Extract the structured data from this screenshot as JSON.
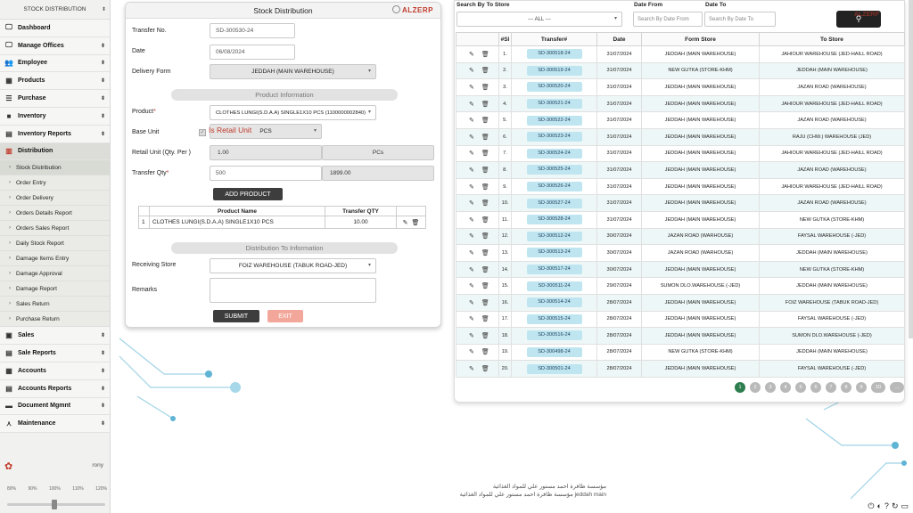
{
  "sidebar": {
    "top_label": "STOCK DISTRIBUTION",
    "menu_before": [
      {
        "label": "Dashboard",
        "icon": "monitor-icon",
        "glyph": "🖵",
        "arrow": ""
      },
      {
        "label": "Manage Offices",
        "icon": "monitor-icon",
        "glyph": "🖵",
        "arrow": "⬍"
      },
      {
        "label": "Employee",
        "icon": "users-icon",
        "glyph": "👥",
        "arrow": "⬍"
      },
      {
        "label": "Products",
        "icon": "grid-icon",
        "glyph": "▦",
        "arrow": "⬍"
      },
      {
        "label": "Purchase",
        "icon": "list-icon",
        "glyph": "☰",
        "arrow": "⬍"
      },
      {
        "label": "Inventory",
        "icon": "box-icon",
        "glyph": "■",
        "arrow": "⬍"
      },
      {
        "label": "Inventory Reports",
        "icon": "chart-icon",
        "glyph": "▤",
        "arrow": "⬍"
      },
      {
        "label": "Distribution",
        "icon": "map-icon",
        "glyph": "▥",
        "arrow": ""
      }
    ],
    "submenu": [
      "Stock Distribution",
      "Order Entry",
      "Order Delivery",
      "Orders Details Report",
      "Orders Sales Report",
      "Daily Stock Report",
      "Damage Items Entry",
      "Damage Approval",
      "Damage Report",
      "Sales Return",
      "Purchase Return"
    ],
    "menu_after": [
      {
        "label": "Sales",
        "icon": "building-icon",
        "glyph": "▣",
        "arrow": "⬍"
      },
      {
        "label": "Sale Reports",
        "icon": "report-icon",
        "glyph": "▤",
        "arrow": "⬍"
      },
      {
        "label": "Accounts",
        "icon": "accounts-icon",
        "glyph": "▦",
        "arrow": "⬍"
      },
      {
        "label": "Accounts Reports",
        "icon": "report-icon",
        "glyph": "▤",
        "arrow": "⬍"
      },
      {
        "label": "Document Mgmnt",
        "icon": "document-icon",
        "glyph": "▬",
        "arrow": "⬍"
      },
      {
        "label": "Maintenance",
        "icon": "wrench-icon",
        "glyph": "⋏",
        "arrow": "⬍"
      }
    ],
    "user": "rony",
    "zoom_levels": [
      "80%",
      "90%",
      "100%",
      "110%",
      "120%"
    ]
  },
  "form": {
    "title": "Stock Distribution",
    "brand": "ALZERP",
    "transfer_no_label": "Transfer No.",
    "transfer_no": "SD-300530-24",
    "date_label": "Date",
    "date": "06/08/2024",
    "delivery_form_label": "Delivery Form",
    "delivery_form": "JEDDAH (MAIN WAREHOUSE)",
    "product_info_label": "Product Information",
    "product_label": "Product",
    "product": "CLOTHES LUNGI(S.D.A.A) SINGLE1X10 PCS (1100000002840)",
    "base_unit_label": "Base Unit",
    "base_unit": "PCS",
    "is_retail_label": "Is Retail Unit",
    "retail_unit_label": "Retail Unit (Qty. Per )",
    "retail_qty": "1.00",
    "retail_unit": "PCs",
    "transfer_qty_label": "Transfer Qty",
    "transfer_qty": "500",
    "transfer_stock": "1899.00",
    "add_product": "ADD PRODUCT",
    "table_headers": {
      "name": "Product Name",
      "qty": "Transfer QTY"
    },
    "rows": [
      {
        "num": "1",
        "name": "CLOTHES LUNGI(S.D.A.A) SINGLE1X10 PCS",
        "qty": "10.00"
      }
    ],
    "dist_to_label": "Distribution To Information",
    "receiving_label": "Receiving Store",
    "receiving_store": "FOIZ WAREHOUSE (TABUK ROAD-JED)",
    "remarks_label": "Remarks",
    "submit": "SUBMIT",
    "exit": "EXIT"
  },
  "filters": {
    "store_label": "Search By To Store",
    "store_value": "--- ALL ---",
    "date_from_label": "Date From",
    "date_from_placeholder": "Search By Date From",
    "date_to_label": "Date To",
    "date_to_placeholder": "Search By Date To",
    "brand": "ALZERP"
  },
  "list": {
    "headers": [
      "",
      "#Sl",
      "Transfer#",
      "Date",
      "Form Store",
      "To Store"
    ],
    "rows": [
      {
        "sl": "1.",
        "transfer": "SD-300518-24",
        "date": "31/07/2024",
        "from": "JEDDAH (MAIN WAREHOUSE)",
        "to": "JAHIOUR WAREHOUSE (JED-HAILL ROAD)"
      },
      {
        "sl": "2.",
        "transfer": "SD-300519-24",
        "date": "31/07/2024",
        "from": "NEW GUTKA (STORE-KHM)",
        "to": "JEDDAH (MAIN WAREHOUSE)"
      },
      {
        "sl": "3.",
        "transfer": "SD-300520-24",
        "date": "31/07/2024",
        "from": "JEDDAH (MAIN WAREHOUSE)",
        "to": "JAZAN ROAD (WAREHOUSE)"
      },
      {
        "sl": "4.",
        "transfer": "SD-300521-24",
        "date": "31/07/2024",
        "from": "JEDDAH (MAIN WAREHOUSE)",
        "to": "JAHIOUR WAREHOUSE (JED-HAILL ROAD)"
      },
      {
        "sl": "5.",
        "transfer": "SD-300522-24",
        "date": "31/07/2024",
        "from": "JEDDAH (MAIN WAREHOUSE)",
        "to": "JAZAN ROAD (WAREHOUSE)"
      },
      {
        "sl": "6.",
        "transfer": "SD-300523-24",
        "date": "31/07/2024",
        "from": "JEDDAH (MAIN WAREHOUSE)",
        "to": "RAJU (CHW.) WAREHOUSE (JED)"
      },
      {
        "sl": "7.",
        "transfer": "SD-300524-24",
        "date": "31/07/2024",
        "from": "JEDDAH (MAIN WAREHOUSE)",
        "to": "JAHIOUR WAREHOUSE (JED-HAILL ROAD)"
      },
      {
        "sl": "8.",
        "transfer": "SD-300525-24",
        "date": "31/07/2024",
        "from": "JEDDAH (MAIN WAREHOUSE)",
        "to": "JAZAN ROAD (WAREHOUSE)"
      },
      {
        "sl": "9.",
        "transfer": "SD-300526-24",
        "date": "31/07/2024",
        "from": "JEDDAH (MAIN WAREHOUSE)",
        "to": "JAHIOUR WAREHOUSE (JED-HAILL ROAD)"
      },
      {
        "sl": "10.",
        "transfer": "SD-300527-24",
        "date": "31/07/2024",
        "from": "JEDDAH (MAIN WAREHOUSE)",
        "to": "JAZAN ROAD (WAREHOUSE)"
      },
      {
        "sl": "11.",
        "transfer": "SD-300528-24",
        "date": "31/07/2024",
        "from": "JEDDAH (MAIN WAREHOUSE)",
        "to": "NEW GUTKA (STORE-KHM)"
      },
      {
        "sl": "12.",
        "transfer": "SD-300512-24",
        "date": "30/07/2024",
        "from": "JAZAN ROAD (WARHOUSE)",
        "to": "FAYSAL WAREHOUSE (-JED)"
      },
      {
        "sl": "13.",
        "transfer": "SD-300513-24",
        "date": "30/07/2024",
        "from": "JAZAN ROAD (WARHOUSE)",
        "to": "JEDDAH (MAIN WAREHOUSE)"
      },
      {
        "sl": "14.",
        "transfer": "SD-300517-24",
        "date": "30/07/2024",
        "from": "JEDDAH (MAIN WAREHOUSE)",
        "to": "NEW GUTKA (STORE-KHM)"
      },
      {
        "sl": "15.",
        "transfer": "SD-300511-24",
        "date": "29/07/2024",
        "from": "SUMON DLO.WAREHOUSE (-JED)",
        "to": "JEDDAH (MAIN WAREHOUSE)"
      },
      {
        "sl": "16.",
        "transfer": "SD-300514-24",
        "date": "28/07/2024",
        "from": "JEDDAH (MAIN WAREHOUSE)",
        "to": "FOIZ WAREHOUSE (TABUK ROAD-JED)"
      },
      {
        "sl": "17.",
        "transfer": "SD-300515-24",
        "date": "28/07/2024",
        "from": "JEDDAH (MAIN WAREHOUSE)",
        "to": "FAYSAL WAREHOUSE (-JED)"
      },
      {
        "sl": "18.",
        "transfer": "SD-300516-24",
        "date": "28/07/2024",
        "from": "JEDDAH (MAIN WAREHOUSE)",
        "to": "SUMON DLO.WAREHOUSE (-JED)"
      },
      {
        "sl": "19.",
        "transfer": "SD-300498-24",
        "date": "28/07/2024",
        "from": "NEW GUTKA (STORE-KHM)",
        "to": "JEDDAH (MAIN WAREHOUSE)"
      },
      {
        "sl": "20.",
        "transfer": "SD-300501-24",
        "date": "28/07/2024",
        "from": "JEDDAH (MAIN WAREHOUSE)",
        "to": "FAYSAL WAREHOUSE (-JED)"
      }
    ],
    "pages": [
      "1",
      "2",
      "3",
      "4",
      "5",
      "6",
      "7",
      "8",
      "9",
      "10",
      "..."
    ]
  },
  "footer": {
    "line1": "مؤسسة ظافرة احمد مستور علي للمواد الغذائية",
    "line2": "مؤسسة ظافرة احمد مستور علي للمواد الغذائية jeddah main"
  },
  "colors": {
    "accent": "#c0392b",
    "pill": "#bfe6f0",
    "pager_active": "#2e7d4f",
    "button_dark": "#3d3d3d"
  }
}
